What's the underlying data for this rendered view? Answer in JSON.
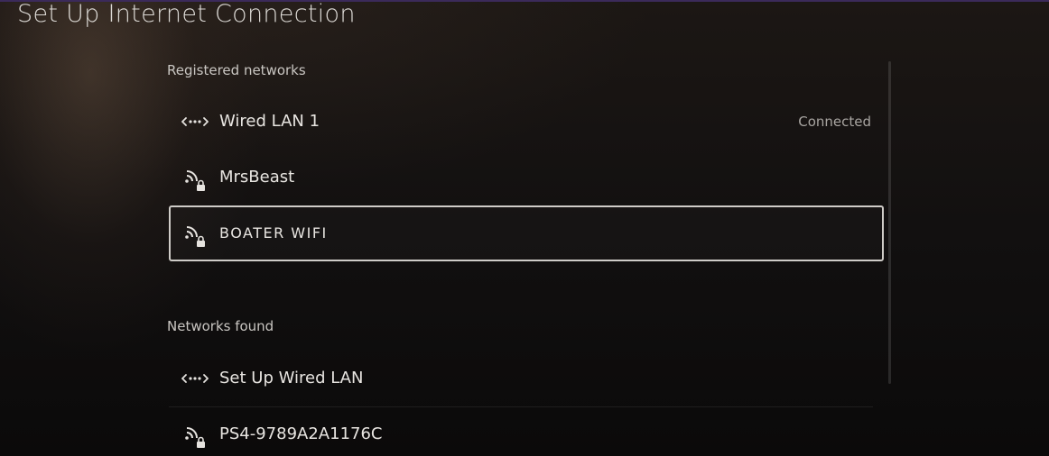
{
  "header": {
    "title": "Set Up Internet Connection"
  },
  "registered": {
    "section_label": "Registered networks",
    "items": [
      {
        "label": "Wired LAN 1",
        "status": "Connected",
        "icon": "wired-lan-icon"
      },
      {
        "label": "MrsBeast",
        "status": "",
        "icon": "wifi-locked-icon"
      },
      {
        "label": "BOATER WIFI",
        "status": "",
        "icon": "wifi-locked-icon",
        "selected": true
      }
    ]
  },
  "found": {
    "section_label": "Networks found",
    "items": [
      {
        "label": "Set Up Wired LAN",
        "icon": "wired-lan-icon"
      },
      {
        "label": "PS4-9789A2A1176C",
        "icon": "wifi-locked-icon"
      }
    ]
  },
  "colors": {
    "background": "#0d0b0a",
    "text": "#e6e3df",
    "selection_border": "#cfccc8",
    "accent_top": "#3b2a5a"
  }
}
